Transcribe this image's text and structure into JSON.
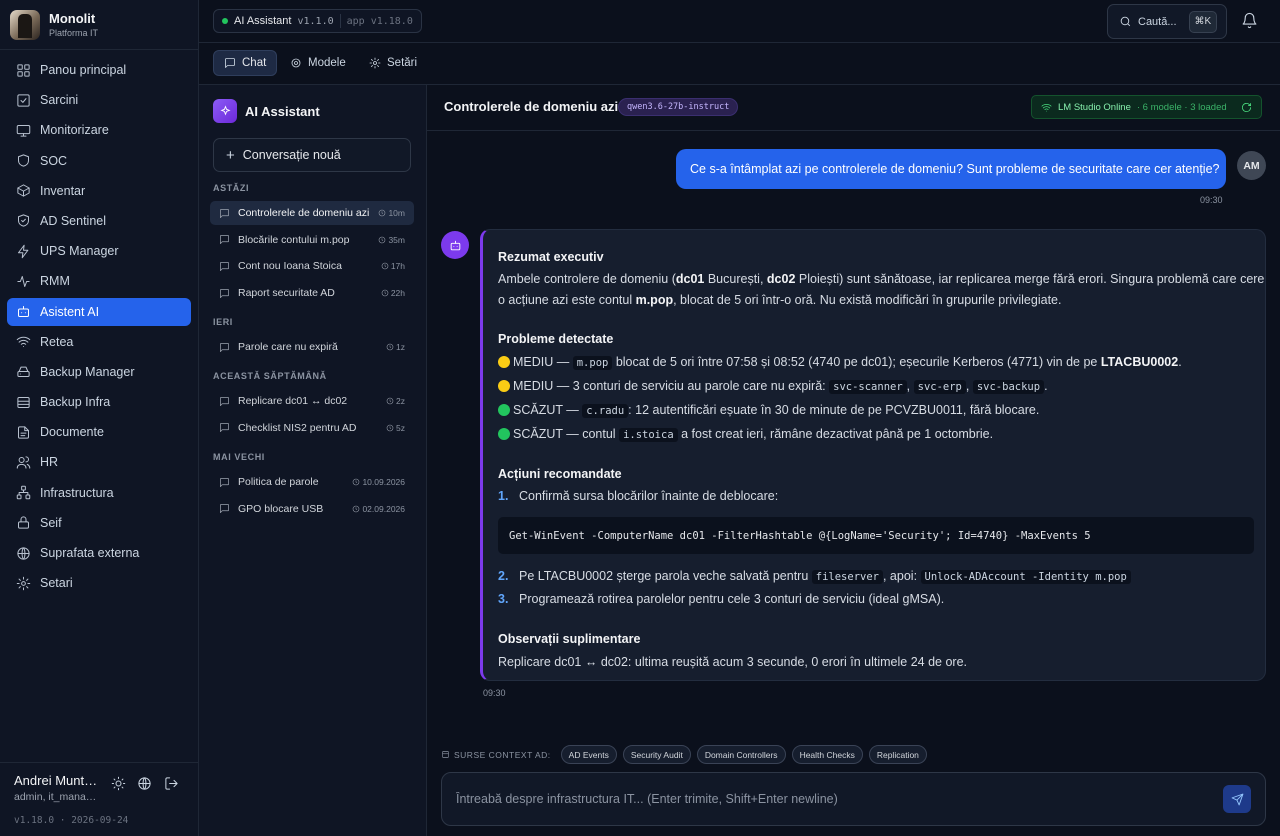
{
  "brand": {
    "name": "Monolit",
    "subtitle": "Platforma IT"
  },
  "nav": [
    {
      "label": "Panou principal",
      "icon": "dashboard-icon"
    },
    {
      "label": "Sarcini",
      "icon": "checkbox-icon"
    },
    {
      "label": "Monitorizare",
      "icon": "monitor-icon"
    },
    {
      "label": "SOC",
      "icon": "shield-icon"
    },
    {
      "label": "Inventar",
      "icon": "box-icon"
    },
    {
      "label": "AD Sentinel",
      "icon": "shield-check-icon"
    },
    {
      "label": "UPS Manager",
      "icon": "bolt-icon"
    },
    {
      "label": "RMM",
      "icon": "activity-icon"
    },
    {
      "label": "Asistent AI",
      "icon": "bot-icon",
      "active": true
    },
    {
      "label": "Retea",
      "icon": "wifi-icon"
    },
    {
      "label": "Backup Manager",
      "icon": "hard-drive-icon"
    },
    {
      "label": "Backup Infra",
      "icon": "database-icon"
    },
    {
      "label": "Documente",
      "icon": "file-icon"
    },
    {
      "label": "HR",
      "icon": "users-icon"
    },
    {
      "label": "Infrastructura",
      "icon": "network-icon"
    },
    {
      "label": "Seif",
      "icon": "lock-icon"
    },
    {
      "label": "Suprafata externa",
      "icon": "globe-icon"
    },
    {
      "label": "Setari",
      "icon": "gear-icon"
    }
  ],
  "user": {
    "name": "Andrei Muntean",
    "role": "admin, it_manager",
    "version": "v1.18.0 · 2026-09-24"
  },
  "topbar": {
    "app_name": "AI Assistant",
    "app_version": "v1.1.0",
    "platform_version": "app v1.18.0",
    "search_label": "Caută...",
    "search_shortcut": "⌘K"
  },
  "tabs": [
    {
      "label": "Chat",
      "active": true
    },
    {
      "label": "Modele"
    },
    {
      "label": "Setări"
    }
  ],
  "panel": {
    "title": "AI Assistant",
    "new_conversation": "Conversație nouă",
    "groups": [
      {
        "label": "ASTĂZI",
        "items": [
          {
            "title": "Controlerele de domeniu azi",
            "time": "10m",
            "active": true
          },
          {
            "title": "Blocările contului m.pop",
            "time": "35m"
          },
          {
            "title": "Cont nou Ioana Stoica",
            "time": "17h"
          },
          {
            "title": "Raport securitate AD",
            "time": "22h"
          }
        ]
      },
      {
        "label": "IERI",
        "items": [
          {
            "title": "Parole care nu expiră",
            "time": "1z"
          }
        ]
      },
      {
        "label": "ACEASTĂ SĂPTĂMÂNĂ",
        "items": [
          {
            "title": "Replicare dc01 ↔ dc02",
            "time": "2z"
          },
          {
            "title": "Checklist NIS2 pentru AD",
            "time": "5z"
          }
        ]
      },
      {
        "label": "MAI VECHI",
        "items": [
          {
            "title": "Politica de parole",
            "time": "10.09.2026"
          },
          {
            "title": "GPO blocare USB",
            "time": "02.09.2026"
          }
        ]
      }
    ]
  },
  "chat": {
    "title": "Controlerele de domeniu azi",
    "model": "qwen3.6-27b-instruct",
    "lm_status": "LM Studio Online",
    "lm_models": "· 6 modele · 3 loaded",
    "user_message": "Ce s-a întâmplat azi pe controlerele de domeniu? Sunt probleme de securitate care cer atenție?",
    "user_initials": "AM",
    "user_time": "09:30",
    "bot_time": "09:30",
    "bot": {
      "h_summary": "Rezumat executiv",
      "summary_1a": "Ambele controlere de domeniu (",
      "summary_dc01": "dc01",
      "summary_1b": " București, ",
      "summary_dc02": "dc02",
      "summary_1c": " Ploiești) sunt sănătoase, iar replicarea merge fără erori. Singura problemă care cere",
      "summary_2a": "o acțiune azi este contul ",
      "summary_mpop": "m.pop",
      "summary_2b": ", blocat de 5 ori într-o oră. Nu există modificări în grupurile privilegiate.",
      "h_problems": "Probleme detectate",
      "p1_sev": "MEDIU — ",
      "p1_code": "m.pop",
      "p1_text": " blocat de 5 ori între 07:58 și 08:52 (4740 pe dc01); eșecurile Kerberos (4771) vin de pe ",
      "p1_host": "LTACBU0002",
      "p1_end": ".",
      "p2_text": "MEDIU — 3 conturi de serviciu au parole care nu expiră: ",
      "p2_c1": "svc-scanner",
      "p2_c2": "svc-erp",
      "p2_c3": "svc-backup",
      "p2_end": ".",
      "p3_sev": "SCĂZUT — ",
      "p3_code": "c.radu",
      "p3_text": ": 12 autentificări eșuate în 30 de minute de pe PCVZBU0011, fără blocare.",
      "p4_sev": "SCĂZUT — contul ",
      "p4_code": "i.stoica",
      "p4_text": " a fost creat ieri, rămâne dezactivat până pe 1 octombrie.",
      "h_actions": "Acțiuni recomandate",
      "a1_num": "1.",
      "a1_text": "Confirmă sursa blocărilor înainte de deblocare:",
      "code": "Get-WinEvent -ComputerName dc01 -FilterHashtable @{LogName='Security'; Id=4740} -MaxEvents 5",
      "a2_num": "2.",
      "a2_text": "Pe LTACBU0002 șterge parola veche salvată pentru ",
      "a2_code1": "fileserver",
      "a2_mid": ", apoi: ",
      "a2_code2": "Unlock-ADAccount -Identity m.pop",
      "a3_num": "3.",
      "a3_text": "Programează rotirea parolelor pentru cele 3 conturi de serviciu (ideal gMSA).",
      "h_obs": "Observații suplimentare",
      "obs_text": "Replicare dc01 ↔ dc02: ultima reușită acum 3 secunde, 0 erori în ultimele 24 de ore."
    },
    "sources_label": "SURSE CONTEXT AD:",
    "sources": [
      "AD Events",
      "Security Audit",
      "Domain Controllers",
      "Health Checks",
      "Replication"
    ],
    "input_placeholder": "Întreabă despre infrastructura IT... (Enter trimite, Shift+Enter newline)"
  },
  "colors": {
    "accent": "#2563eb",
    "assistant": "#7c3aed",
    "online": "#22c55e",
    "warning": "#facc15",
    "low": "#22c55e"
  }
}
